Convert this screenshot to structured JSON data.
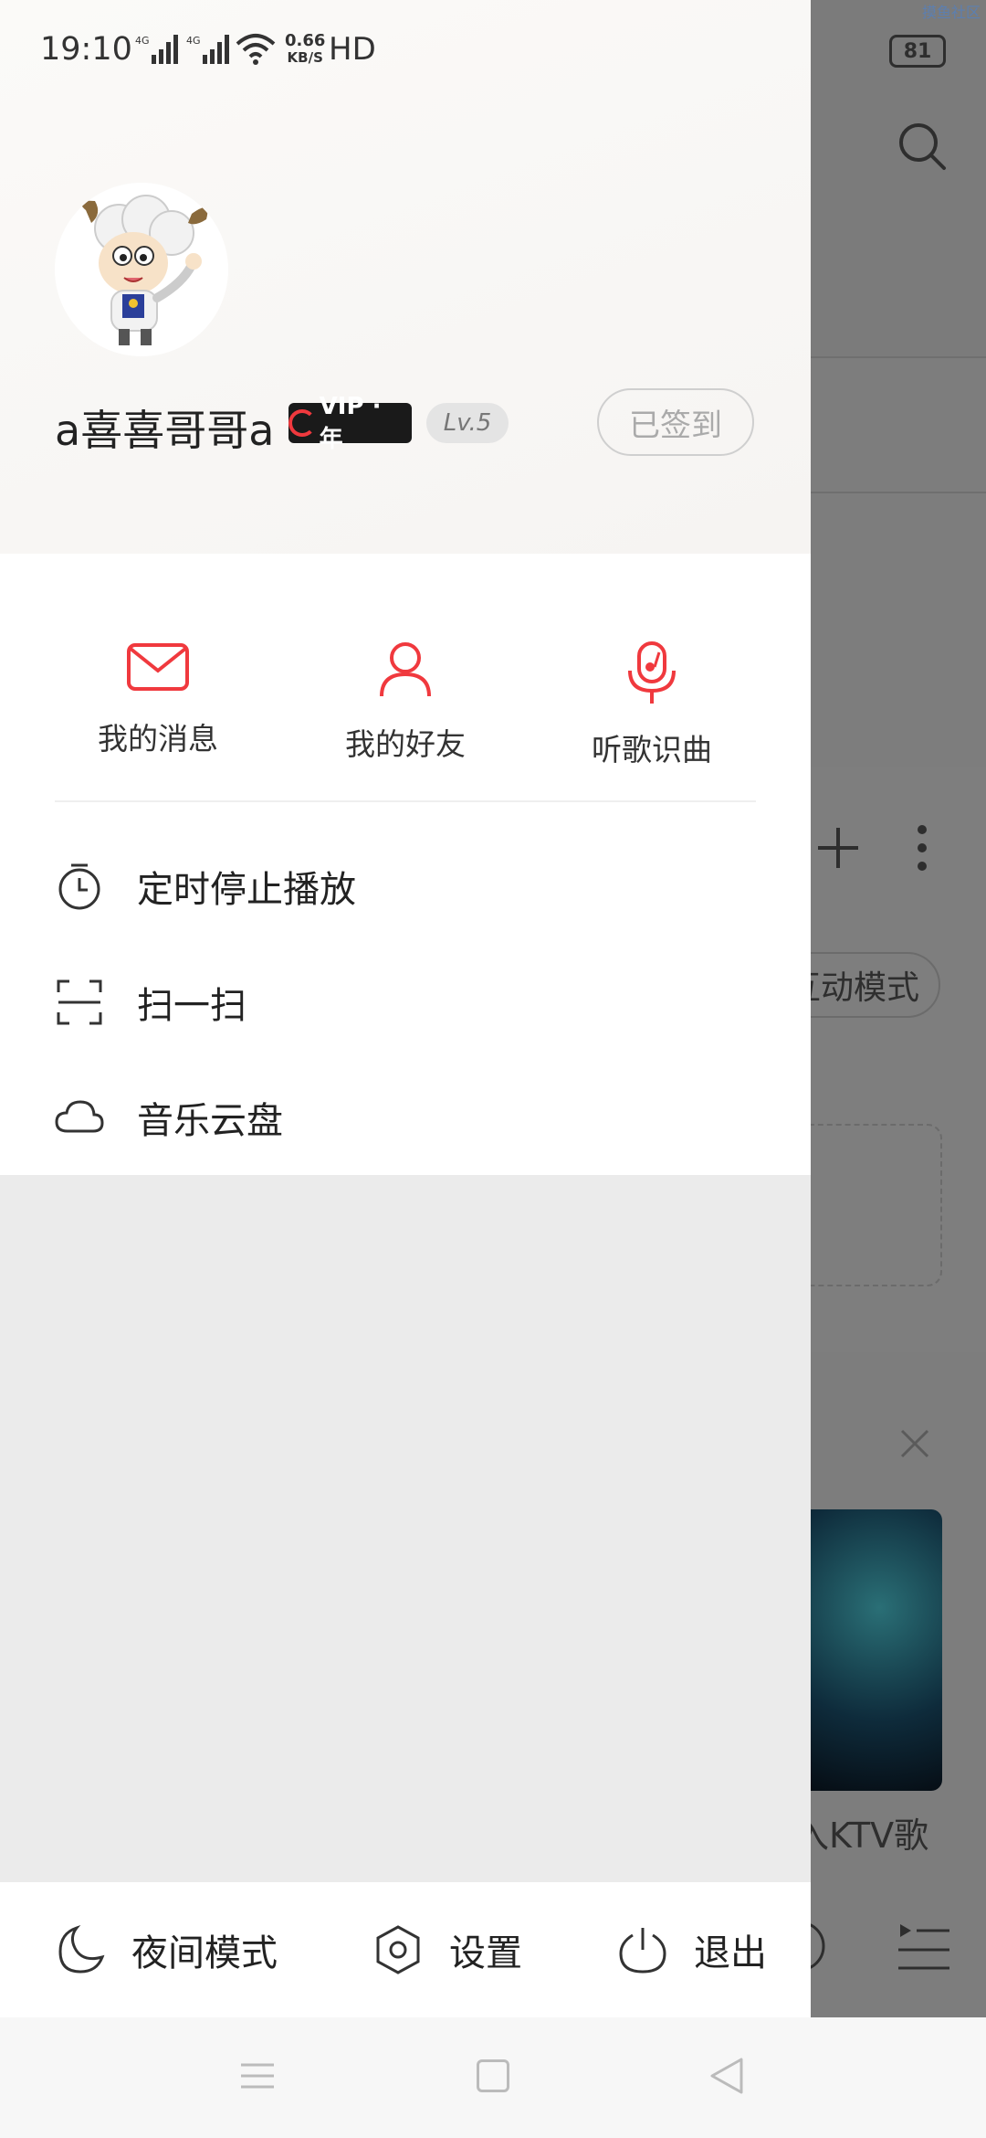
{
  "status_bar": {
    "time": "19:10",
    "net_speed": "0.66",
    "net_unit": "KB/S",
    "hd": "HD",
    "battery": "81"
  },
  "background": {
    "ktv_text": "入KTV歌",
    "mode_chip": "互动模式",
    "corner_text": "摸鱼社区"
  },
  "profile": {
    "username": "a喜喜哥哥a",
    "vip_badge": "VIP · 年",
    "level": "Lv.5",
    "signin_label": "已签到"
  },
  "quick_actions": [
    {
      "label": "我的消息",
      "icon": "mail-icon"
    },
    {
      "label": "我的好友",
      "icon": "person-icon"
    },
    {
      "label": "听歌识曲",
      "icon": "mic-music-icon"
    }
  ],
  "menu": [
    {
      "label": "定时停止播放",
      "icon": "timer-icon"
    },
    {
      "label": "扫一扫",
      "icon": "scan-icon"
    },
    {
      "label": "音乐云盘",
      "icon": "cloud-icon"
    }
  ],
  "bottom": {
    "night_mode": "夜间模式",
    "settings": "设置",
    "logout": "退出"
  },
  "colors": {
    "accent": "#f0393e",
    "drawer_bg": "#ebebeb"
  }
}
